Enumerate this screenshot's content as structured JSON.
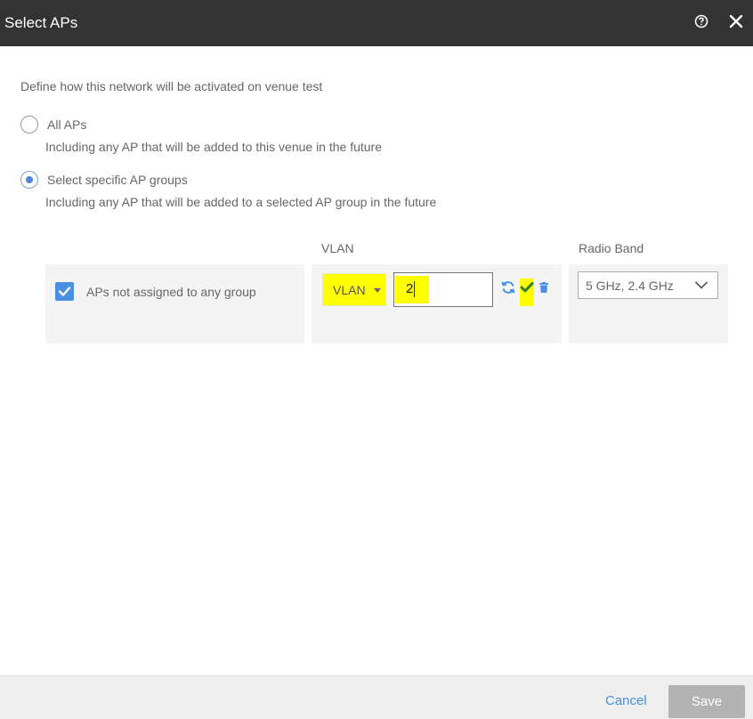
{
  "dialog": {
    "title": "Select APs"
  },
  "intro_text": "Define how this network will be activated on venue test",
  "options": [
    {
      "label": "All APs",
      "description": "Including any AP that will be added to this venue in the future",
      "selected": false
    },
    {
      "label": "Select specific AP groups",
      "description": "Including any AP that will be added to a selected AP group in the future",
      "selected": true
    }
  ],
  "table": {
    "headers": {
      "vlan": "VLAN",
      "radio_band": "Radio Band"
    },
    "row": {
      "label": "APs not assigned to any group",
      "checked": true,
      "vlan_type": "VLAN",
      "vlan_value": "2",
      "radio_band": "5 GHz, 2.4 GHz"
    }
  },
  "footer": {
    "cancel_label": "Cancel",
    "save_label": "Save"
  },
  "icons": {
    "help": "help-circle-icon",
    "close": "close-icon",
    "refresh": "refresh-icon",
    "confirm": "check-icon",
    "delete": "trash-icon"
  },
  "colors": {
    "titlebar": "#333333",
    "accent": "#4a90e2",
    "highlight": "#fefe00",
    "save_disabled": "#b3b3b3"
  }
}
